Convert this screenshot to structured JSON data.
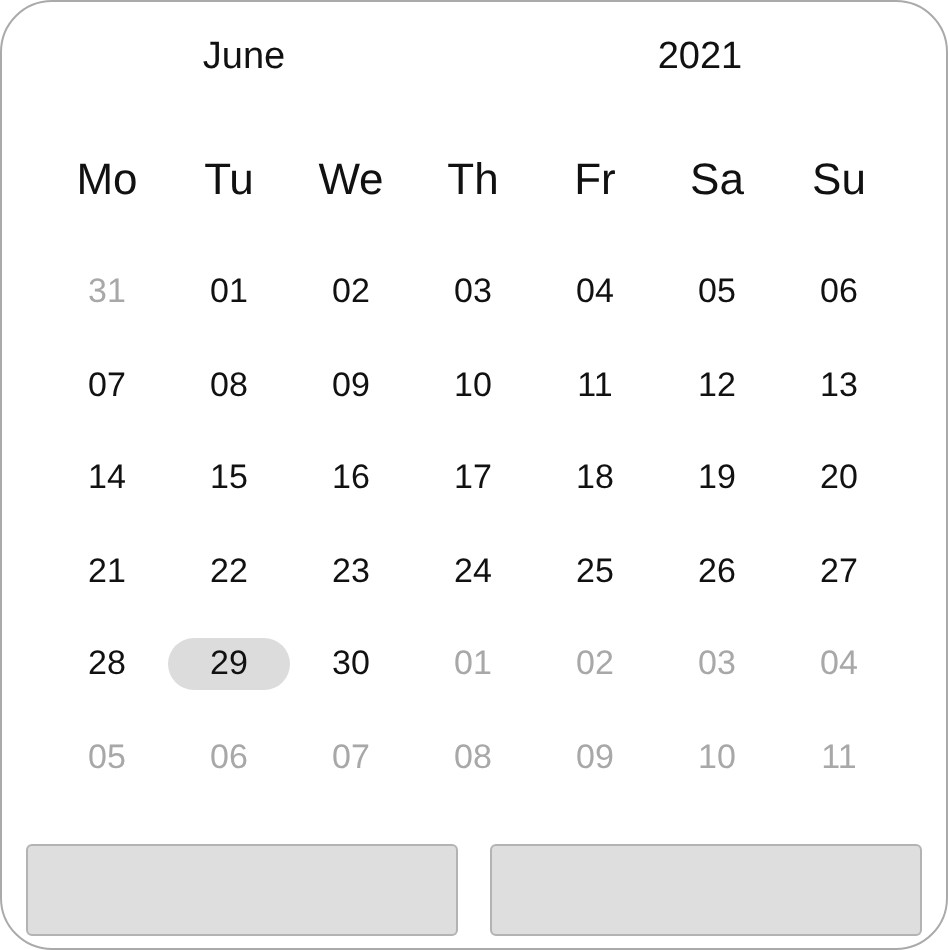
{
  "header": {
    "month": "June",
    "year": "2021"
  },
  "weekdays": [
    "Mo",
    "Tu",
    "We",
    "Th",
    "Fr",
    "Sa",
    "Su"
  ],
  "weeks": [
    [
      {
        "day": "31",
        "outside": true,
        "selected": false
      },
      {
        "day": "01",
        "outside": false,
        "selected": false
      },
      {
        "day": "02",
        "outside": false,
        "selected": false
      },
      {
        "day": "03",
        "outside": false,
        "selected": false
      },
      {
        "day": "04",
        "outside": false,
        "selected": false
      },
      {
        "day": "05",
        "outside": false,
        "selected": false
      },
      {
        "day": "06",
        "outside": false,
        "selected": false
      }
    ],
    [
      {
        "day": "07",
        "outside": false,
        "selected": false
      },
      {
        "day": "08",
        "outside": false,
        "selected": false
      },
      {
        "day": "09",
        "outside": false,
        "selected": false
      },
      {
        "day": "10",
        "outside": false,
        "selected": false
      },
      {
        "day": "11",
        "outside": false,
        "selected": false
      },
      {
        "day": "12",
        "outside": false,
        "selected": false
      },
      {
        "day": "13",
        "outside": false,
        "selected": false
      }
    ],
    [
      {
        "day": "14",
        "outside": false,
        "selected": false
      },
      {
        "day": "15",
        "outside": false,
        "selected": false
      },
      {
        "day": "16",
        "outside": false,
        "selected": false
      },
      {
        "day": "17",
        "outside": false,
        "selected": false
      },
      {
        "day": "18",
        "outside": false,
        "selected": false
      },
      {
        "day": "19",
        "outside": false,
        "selected": false
      },
      {
        "day": "20",
        "outside": false,
        "selected": false
      }
    ],
    [
      {
        "day": "21",
        "outside": false,
        "selected": false
      },
      {
        "day": "22",
        "outside": false,
        "selected": false
      },
      {
        "day": "23",
        "outside": false,
        "selected": false
      },
      {
        "day": "24",
        "outside": false,
        "selected": false
      },
      {
        "day": "25",
        "outside": false,
        "selected": false
      },
      {
        "day": "26",
        "outside": false,
        "selected": false
      },
      {
        "day": "27",
        "outside": false,
        "selected": false
      }
    ],
    [
      {
        "day": "28",
        "outside": false,
        "selected": false
      },
      {
        "day": "29",
        "outside": false,
        "selected": true
      },
      {
        "day": "30",
        "outside": false,
        "selected": false
      },
      {
        "day": "01",
        "outside": true,
        "selected": false
      },
      {
        "day": "02",
        "outside": true,
        "selected": false
      },
      {
        "day": "03",
        "outside": true,
        "selected": false
      },
      {
        "day": "04",
        "outside": true,
        "selected": false
      }
    ],
    [
      {
        "day": "05",
        "outside": true,
        "selected": false
      },
      {
        "day": "06",
        "outside": true,
        "selected": false
      },
      {
        "day": "07",
        "outside": true,
        "selected": false
      },
      {
        "day": "08",
        "outside": true,
        "selected": false
      },
      {
        "day": "09",
        "outside": true,
        "selected": false
      },
      {
        "day": "10",
        "outside": true,
        "selected": false
      },
      {
        "day": "11",
        "outside": true,
        "selected": false
      }
    ]
  ]
}
